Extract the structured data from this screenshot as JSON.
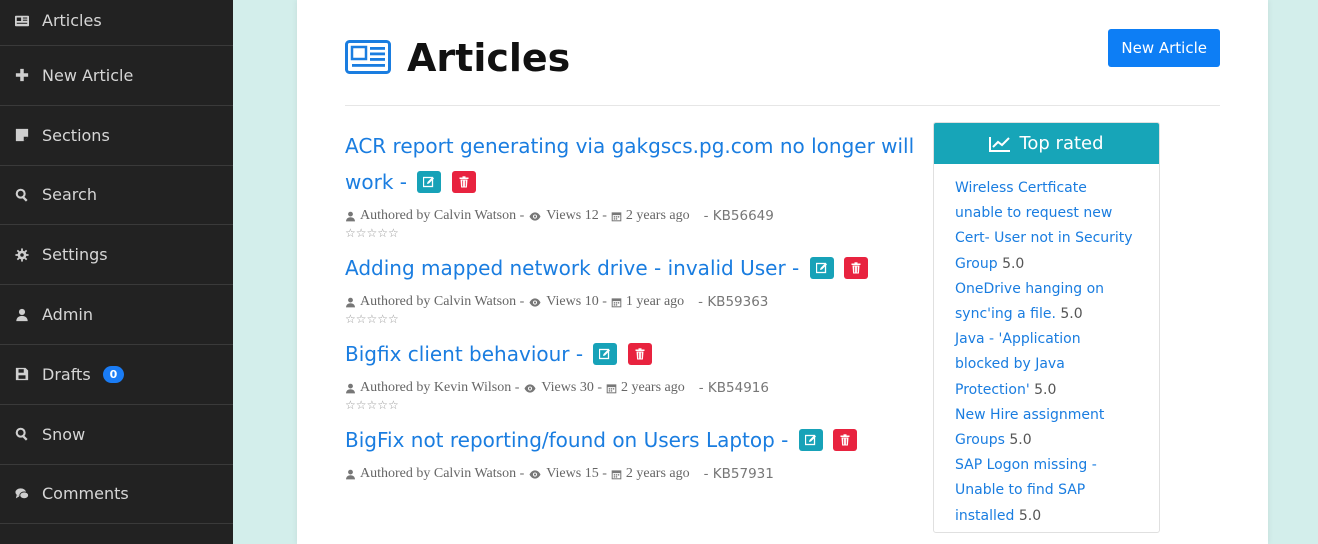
{
  "sidebar": {
    "items": [
      {
        "label": "Articles",
        "icon": "newspaper-icon"
      },
      {
        "label": "New Article",
        "icon": "plus-icon"
      },
      {
        "label": "Sections",
        "icon": "sticky-note-icon"
      },
      {
        "label": "Search",
        "icon": "search-icon"
      },
      {
        "label": "Settings",
        "icon": "gear-icon"
      },
      {
        "label": "Admin",
        "icon": "user-icon"
      },
      {
        "label": "Drafts",
        "icon": "save-icon",
        "badge": "0"
      },
      {
        "label": "Snow",
        "icon": "search-icon"
      },
      {
        "label": "Comments",
        "icon": "comments-icon"
      }
    ]
  },
  "page": {
    "title": "Articles",
    "new_article_label": "New Article"
  },
  "articles": [
    {
      "title": "ACR report generating via gakgscs.pg.com no longer will work -",
      "author": "Authored by Calvin Watson -",
      "views": "Views 12 -",
      "age": "2 years ago",
      "kb": "- KB56649",
      "stars": "☆☆☆☆☆"
    },
    {
      "title": "Adding mapped network drive - invalid User -",
      "author": "Authored by Calvin Watson -",
      "views": "Views 10 -",
      "age": "1 year ago",
      "kb": "- KB59363",
      "stars": "☆☆☆☆☆"
    },
    {
      "title": "Bigfix client behaviour -",
      "author": "Authored by Kevin Wilson -",
      "views": "Views 30 -",
      "age": "2 years ago",
      "kb": "- KB54916",
      "stars": "☆☆☆☆☆"
    },
    {
      "title": "BigFix not reporting/found on Users Laptop -",
      "author": "Authored by Calvin Watson -",
      "views": "Views 15 -",
      "age": "2 years ago",
      "kb": "- KB57931",
      "stars": ""
    }
  ],
  "top_rated": {
    "title": "Top rated",
    "items": [
      {
        "title": "Wireless Certficate unable to request new Cert- User not in Security Group",
        "score": "5.0"
      },
      {
        "title": "OneDrive hanging on sync'ing a file.",
        "score": "5.0"
      },
      {
        "title": "Java - 'Application blocked by Java Protection'",
        "score": "5.0"
      },
      {
        "title": "New Hire assignment Groups",
        "score": "5.0"
      },
      {
        "title": "SAP Logon missing - Unable to find SAP installed",
        "score": "5.0"
      }
    ]
  },
  "colors": {
    "accent": "#0d7ef5",
    "link": "#1a7de0",
    "sidebar_bg": "#222222",
    "panel_header": "#17a5b8",
    "edit_btn": "#17a2b8",
    "delete_btn": "#e8233f"
  }
}
